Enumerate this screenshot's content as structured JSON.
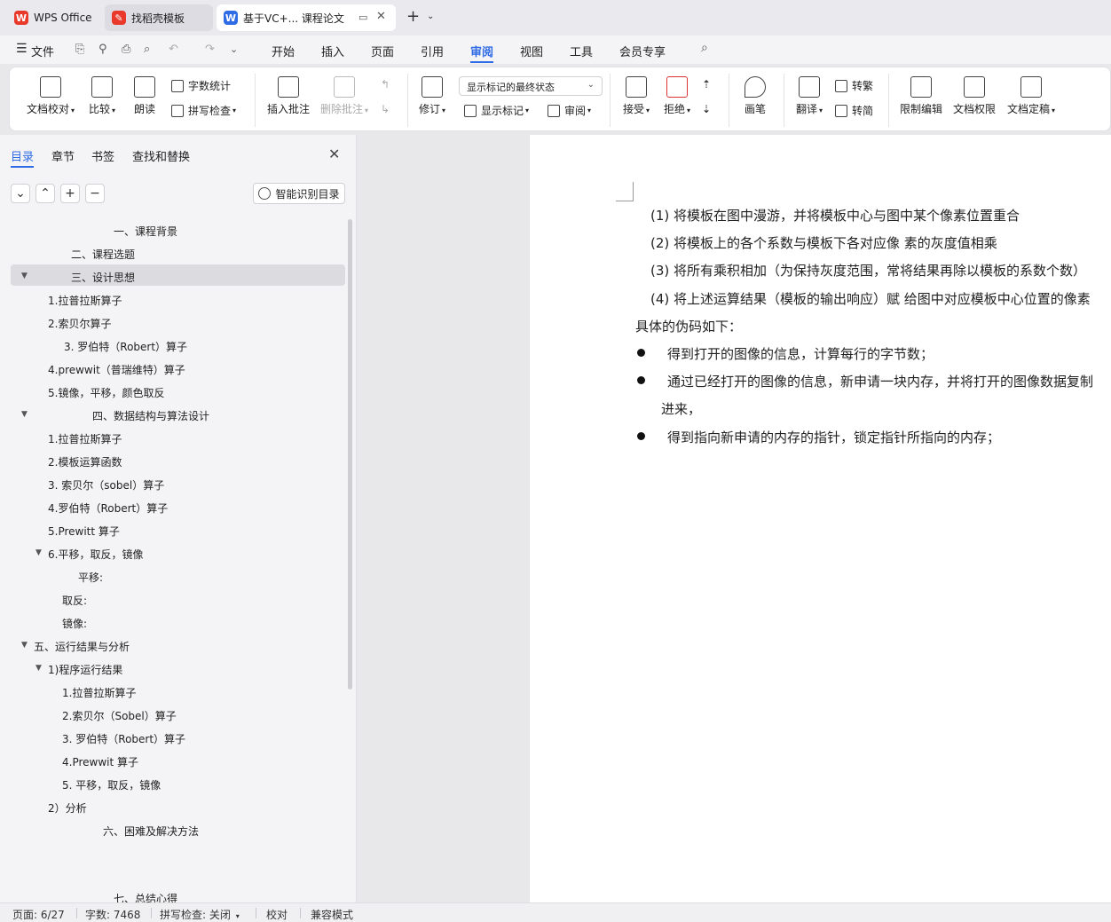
{
  "tabs": {
    "wps": "WPS Office",
    "daoke": "找稻壳模板",
    "doc": "基于VC+... 课程论文"
  },
  "menu": {
    "file": "文件",
    "items": [
      "开始",
      "插入",
      "页面",
      "引用",
      "审阅",
      "视图",
      "工具",
      "会员专享"
    ],
    "active": "审阅"
  },
  "ribbon": {
    "doc_check": "文档校对",
    "compare": "比较",
    "read_aloud": "朗读",
    "word_count": "字数统计",
    "spell_check": "拼写检查",
    "insert_comment": "插入批注",
    "delete_comment": "删除批注",
    "revise": "修订",
    "markup_combo": "显示标记的最终状态",
    "show_markup": "显示标记",
    "review": "审阅",
    "accept": "接受",
    "reject": "拒绝",
    "pen": "画笔",
    "translate": "翻译",
    "to_traditional": "转繁",
    "to_simplified": "转简",
    "restrict_edit": "限制编辑",
    "doc_permission": "文档权限",
    "doc_finalize": "文档定稿"
  },
  "panel": {
    "tabs": [
      "目录",
      "章节",
      "书签",
      "查找和替换"
    ],
    "smart_button": "智能识别目录",
    "toc": [
      "一、课程背景",
      "二、课程选题",
      "三、设计思想",
      "1.拉普拉斯算子",
      "2.索贝尔算子",
      "3. 罗伯特（Robert）算子",
      "4.prewwit（普瑞维特）算子",
      "5.镜像，平移，颜色取反",
      "四、数据结构与算法设计",
      "1.拉普拉斯算子",
      "2.模板运算函数",
      "3. 索贝尔（sobel）算子",
      "4.罗伯特（Robert）算子",
      "5.Prewitt 算子",
      "6.平移，取反，镜像",
      "平移:",
      "取反:",
      "镜像:",
      "五、运行结果与分析",
      "1)程序运行结果",
      "1.拉普拉斯算子",
      "2.索贝尔（Sobel）算子",
      "3. 罗伯特（Robert）算子",
      "4.Prewwit 算子",
      "5. 平移，取反，镜像",
      "2）分析",
      "六、困难及解决方法",
      "七、总结心得"
    ]
  },
  "doc": {
    "steps": [
      "(1)  将模板在图中漫游，并将模板中心与图中某个像素位置重合",
      "(2)  将模板上的各个系数与模板下各对应像  素的灰度值相乘",
      "(3)  将所有乘积相加（为保持灰度范围，常将结果再除以模板的系数个数）",
      "(4)  将上述运算结果（模板的输出响应）赋  给图中对应模板中心位置的像素"
    ],
    "pseudo_intro": "具体的伪码如下：",
    "bullets": [
      "得到打开的图像的信息，计算每行的字节数；",
      "通过已经打开的图像的信息，新申请一块内存，并将打开的图像数据复制",
      "进来，",
      "得到指向新申请的内存的指针，锁定指针所指向的内存；"
    ]
  },
  "status": {
    "page": "页面: 6/27",
    "words": "字数: 7468",
    "spell": "拼写检查: 关闭",
    "proof": "校对",
    "compat": "兼容模式"
  }
}
